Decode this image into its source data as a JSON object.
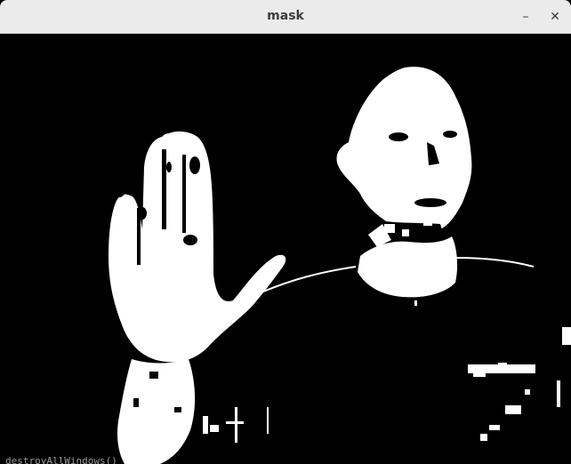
{
  "window": {
    "title": "mask",
    "minimize_glyph": "–",
    "close_glyph": "✕"
  },
  "image": {
    "description_colors": {
      "foreground": "#ffffff",
      "background": "#000000"
    }
  },
  "background_terminal": {
    "partial_text": "destroyAllWindows()"
  },
  "icons": {
    "minimize": "minimize-icon",
    "close": "close-icon"
  }
}
